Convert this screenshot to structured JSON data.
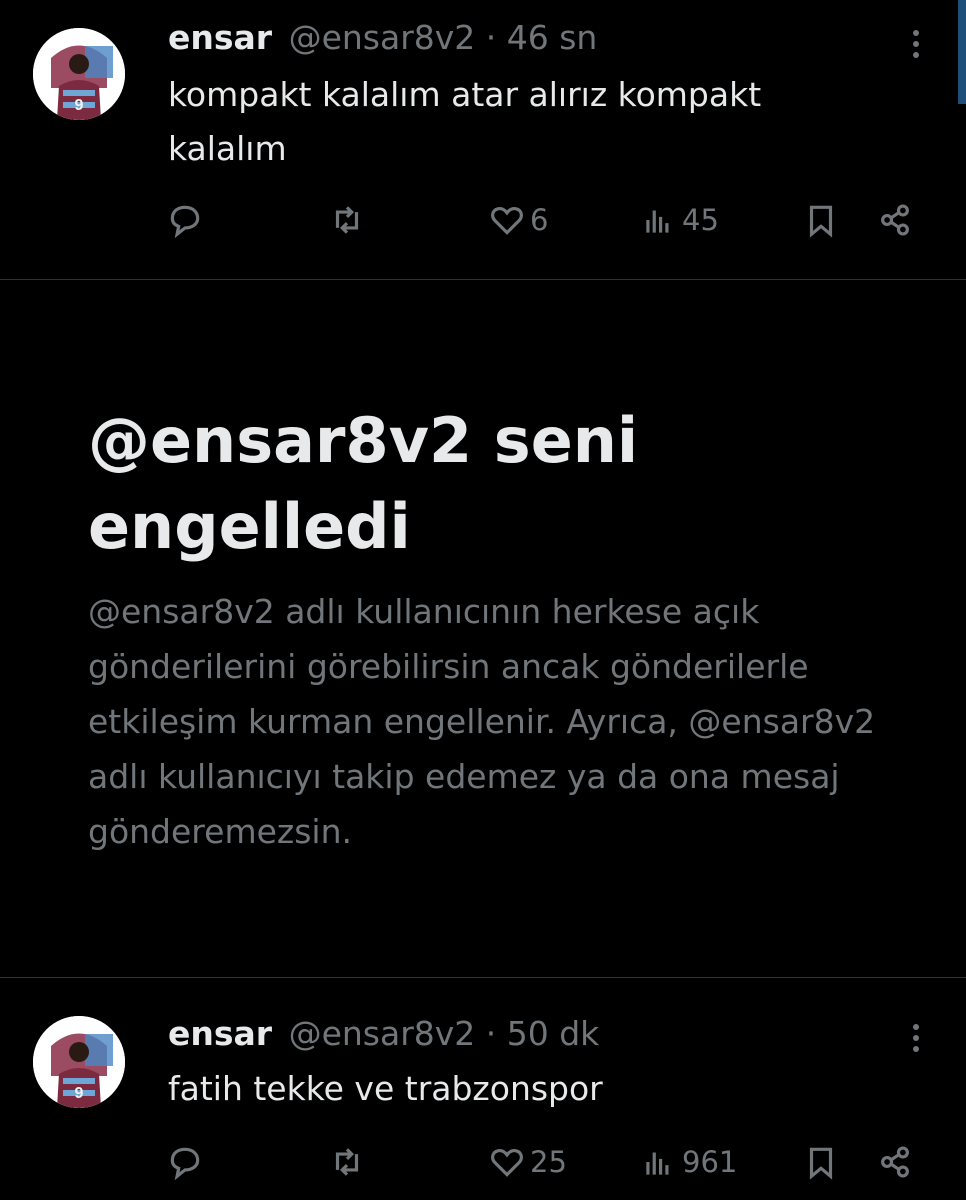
{
  "tweets": [
    {
      "display_name": "ensar",
      "handle_time": "@ensar8v2 · 46 sn",
      "text": "kompakt kalalım atar alırız kompakt kalalım",
      "likes": "6",
      "views": "45",
      "avatar_icon": "trabzonspor-player-avatar"
    },
    {
      "display_name": "ensar",
      "handle_time": "@ensar8v2 · 50 dk",
      "text": "fatih tekke ve trabzonspor",
      "likes": "25",
      "views": "961",
      "avatar_icon": "trabzonspor-player-avatar"
    }
  ],
  "blocked": {
    "title": "@ensar8v2 seni engelledi",
    "description": "@ensar8v2 adlı kullanıcının herkese açık gönderilerini görebilirsin ancak gönderilerle etkileşim kurman engellenir. Ayrıca, @ensar8v2 adlı kullanıcıyı takip edemez ya da ona mesaj gönderemezsin."
  },
  "colors": {
    "background": "#000000",
    "text_primary": "#e7e9ea",
    "text_secondary": "#71767b",
    "divider": "#2f3336"
  }
}
